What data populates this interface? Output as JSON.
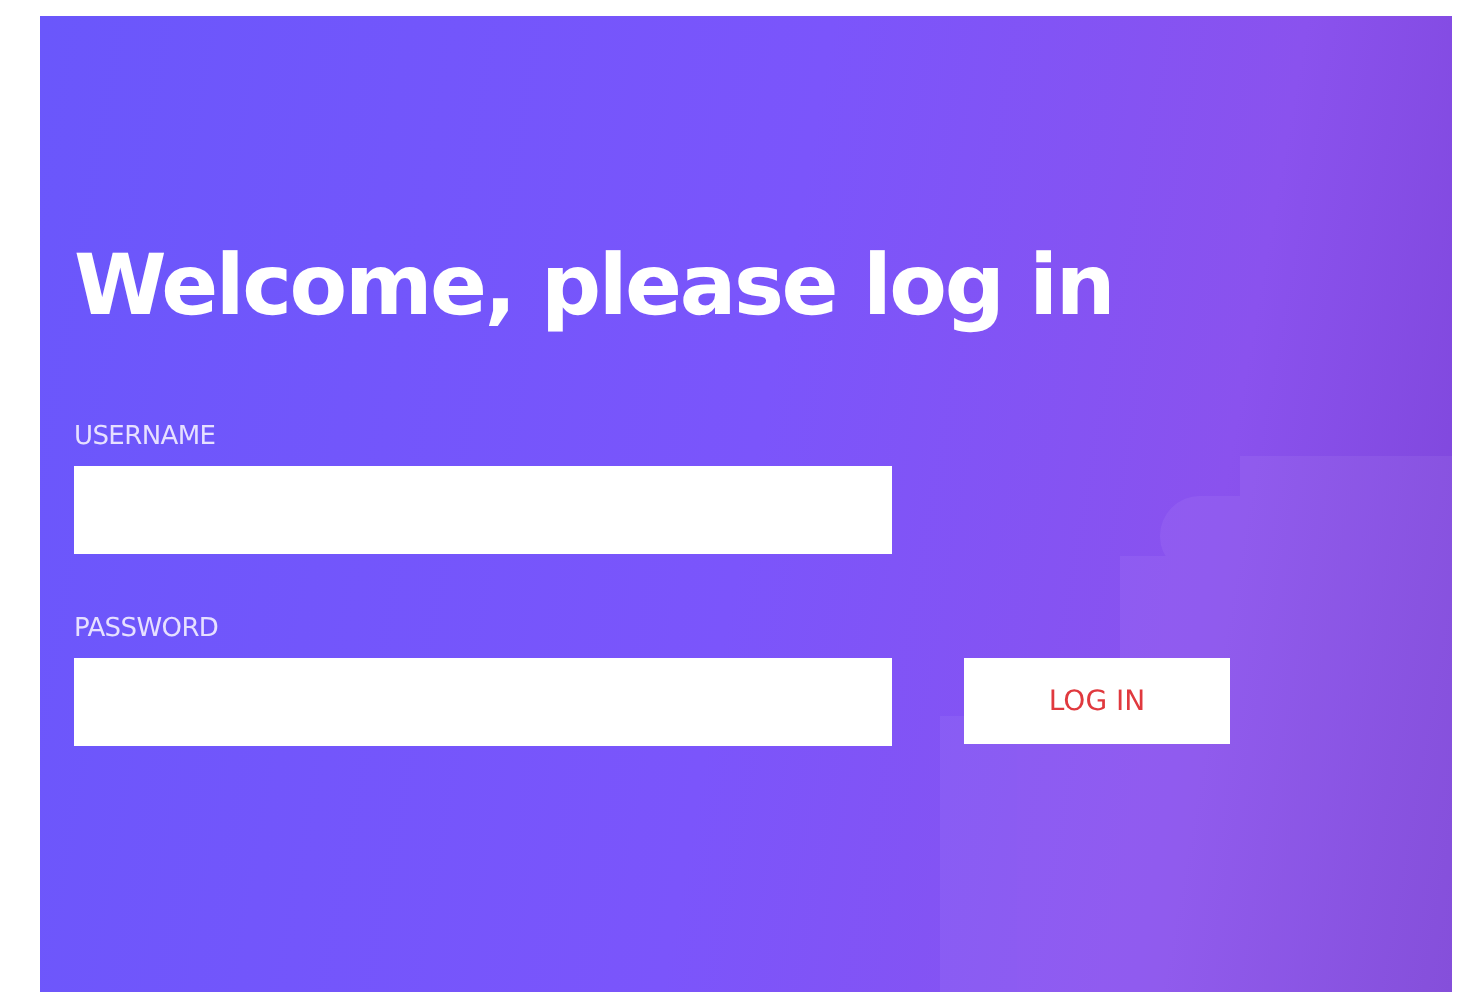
{
  "title": "Welcome, please log in",
  "fields": [
    {
      "label": "USERNAME"
    },
    {
      "label": "PASSWORD"
    }
  ],
  "button": {
    "label": "LOG IN"
  }
}
